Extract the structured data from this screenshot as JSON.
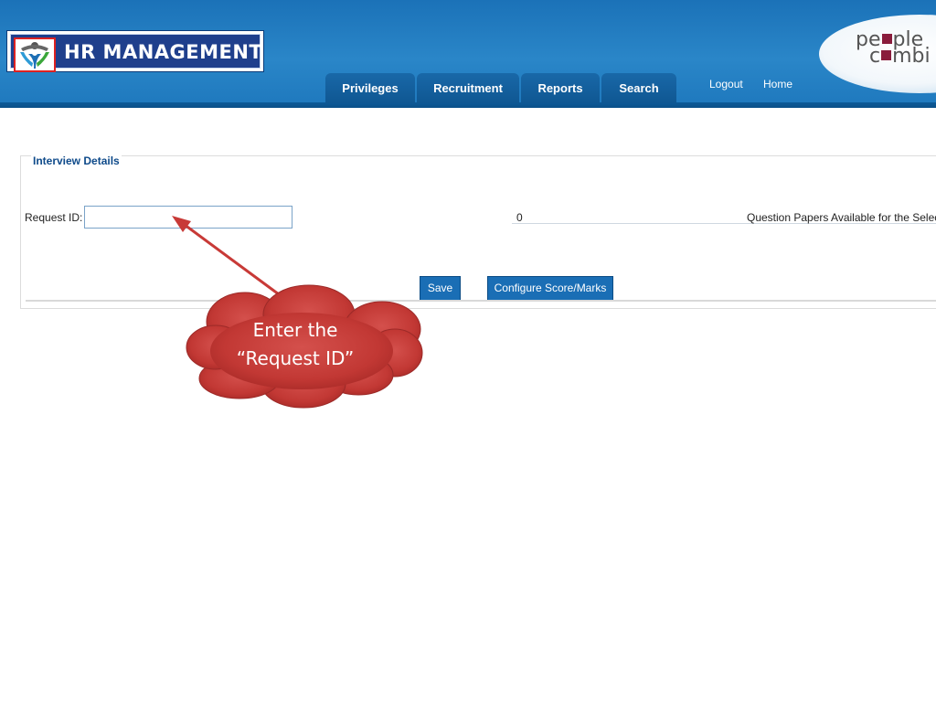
{
  "header": {
    "title": "HR MANAGEMENT",
    "brand_line1_a": "pe",
    "brand_line1_b": "ple",
    "brand_line2_a": "c",
    "brand_line2_b": "mbi",
    "colors": {
      "header_blue": "#1e78bd",
      "tab_blue": "#0f5792",
      "brand_accent": "#8a1c3c"
    }
  },
  "nav": {
    "tabs": [
      {
        "label": "Privileges"
      },
      {
        "label": "Recruitment"
      },
      {
        "label": "Reports"
      },
      {
        "label": "Search"
      }
    ],
    "logout": "Logout",
    "home": "Home"
  },
  "panel": {
    "title": "Interview Details",
    "request_id_label": "Request ID:",
    "request_id_value": "",
    "count_value": "0",
    "question_papers_label": "Question Papers Available for the Selec",
    "save_label": "Save",
    "configure_label": "Configure Score/Marks"
  },
  "callout": {
    "line1": "Enter the",
    "line2": "“Request ID”",
    "color": "#c83a37"
  }
}
